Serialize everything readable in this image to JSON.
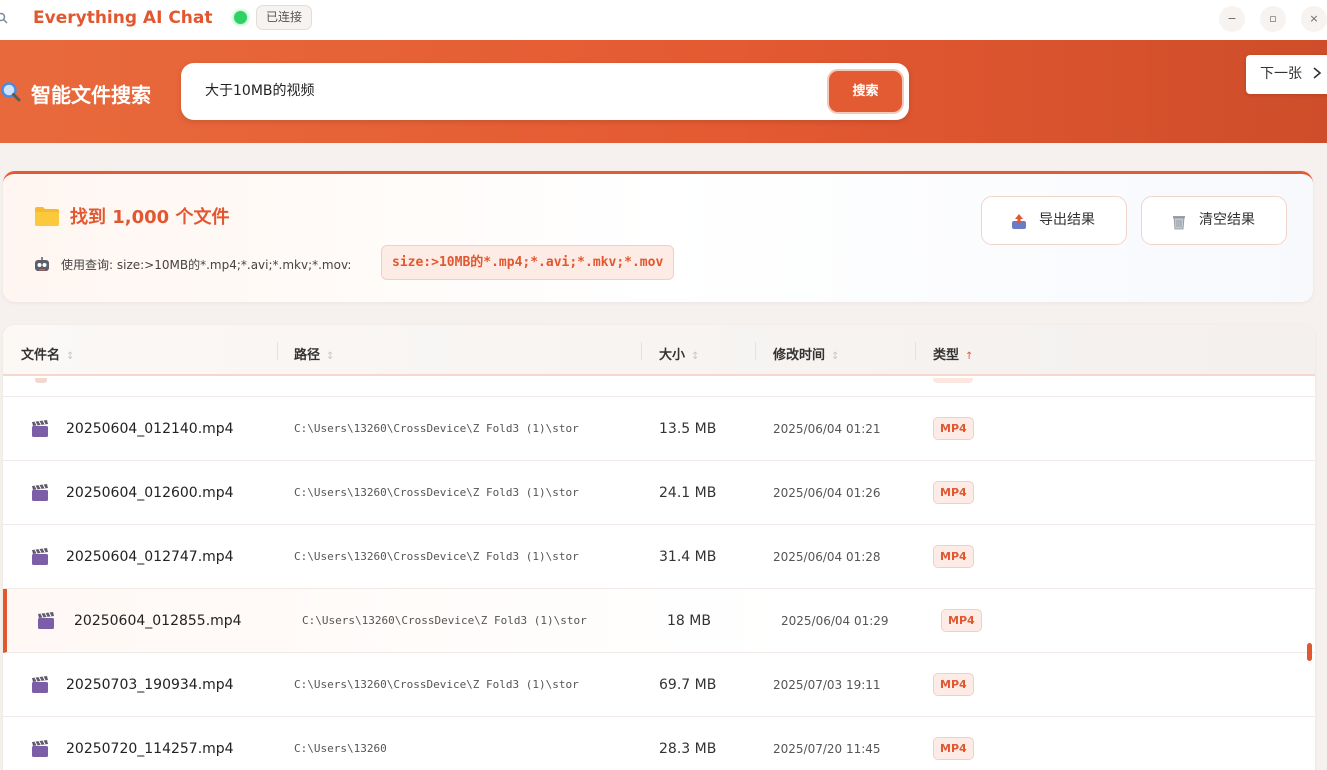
{
  "titlebar": {
    "app_title": "Everything AI Chat",
    "status": "已连接",
    "minimize_glyph": "−",
    "maximize_glyph": "▫",
    "close_glyph": "×"
  },
  "search": {
    "title": "智能文件搜索",
    "query": "大于10MB的视频",
    "button": "搜索",
    "next": "下一张"
  },
  "summary": {
    "title": "找到 1,000 个文件",
    "query_label": "使用查询: size:>10MB的*.mp4;*.avi;*.mkv;*.mov:",
    "query_code": "size:>10MB的*.mp4;*.avi;*.mkv;*.mov",
    "export_label": "导出结果",
    "clear_label": "清空结果"
  },
  "table": {
    "columns": [
      "文件名",
      "路径",
      "大小",
      "修改时间",
      "类型"
    ],
    "sort_idle": "↕",
    "sort_active": "↑",
    "rows": [
      {
        "name": "20250604_012140.mp4",
        "path": "C:\\Users\\13260\\CrossDevice\\Z Fold3 (1)\\stor",
        "size": "13.5 MB",
        "modified": "2025/06/04 01:21",
        "type": "MP4"
      },
      {
        "name": "20250604_012600.mp4",
        "path": "C:\\Users\\13260\\CrossDevice\\Z Fold3 (1)\\stor",
        "size": "24.1 MB",
        "modified": "2025/06/04 01:26",
        "type": "MP4"
      },
      {
        "name": "20250604_012747.mp4",
        "path": "C:\\Users\\13260\\CrossDevice\\Z Fold3 (1)\\stor",
        "size": "31.4 MB",
        "modified": "2025/06/04 01:28",
        "type": "MP4"
      },
      {
        "name": "20250604_012855.mp4",
        "path": "C:\\Users\\13260\\CrossDevice\\Z Fold3 (1)\\stor",
        "size": "18 MB",
        "modified": "2025/06/04 01:29",
        "type": "MP4"
      },
      {
        "name": "20250703_190934.mp4",
        "path": "C:\\Users\\13260\\CrossDevice\\Z Fold3 (1)\\stor",
        "size": "69.7 MB",
        "modified": "2025/07/03 19:11",
        "type": "MP4"
      },
      {
        "name": "20250720_114257.mp4",
        "path": "C:\\Users\\13260",
        "size": "28.3 MB",
        "modified": "2025/07/20 11:45",
        "type": "MP4"
      }
    ]
  },
  "colors": {
    "accent": "#e2572f",
    "banner": "#e45a32",
    "connected": "#2fd262"
  },
  "icons": [
    "magnifier-icon",
    "folder-icon",
    "robot-icon",
    "export-icon",
    "trash-icon",
    "clapperboard-icon",
    "chevron-right-icon"
  ]
}
